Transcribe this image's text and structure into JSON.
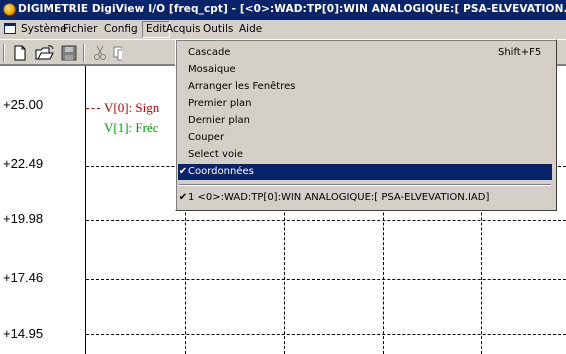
{
  "window": {
    "title": "DIGIMETRIE DigiView I/O [freq_cpt] - [<0>:WAD:TP[0]:WIN ANALOGIQUE:[ PSA-ELVEVATION.IAD]"
  },
  "menubar": {
    "items": [
      "Système",
      "Fichier",
      "Config",
      "Edit",
      "Acquis",
      "Outils",
      "Aide"
    ]
  },
  "edit_menu": {
    "items": [
      {
        "label": "Cascade",
        "shortcut": "Shift+F5",
        "checked": false,
        "selected": false
      },
      {
        "label": "Mosaique",
        "shortcut": "",
        "checked": false,
        "selected": false
      },
      {
        "label": "Arranger les Fenêtres",
        "shortcut": "",
        "checked": false,
        "selected": false
      },
      {
        "label": "Premier plan",
        "shortcut": "",
        "checked": false,
        "selected": false
      },
      {
        "label": "Dernier plan",
        "shortcut": "",
        "checked": false,
        "selected": false
      },
      {
        "label": "Couper",
        "shortcut": "",
        "checked": false,
        "selected": false
      },
      {
        "label": "Select voie",
        "shortcut": "",
        "checked": false,
        "selected": false
      },
      {
        "label": "Coordonnées",
        "shortcut": "",
        "checked": true,
        "selected": true
      }
    ],
    "window_list": [
      {
        "label": "1 <0>:WAD:TP[0]:WIN ANALOGIQUE:[ PSA-ELVEVATION.IAD]",
        "checked": true
      }
    ]
  },
  "plot": {
    "yticks": [
      "+25.00",
      "+22.49",
      "+19.98",
      "+17.46",
      "+14.95"
    ],
    "legend": [
      {
        "text": "V[0]: Sign",
        "color": "#c00000"
      },
      {
        "text": "V[1]: Fréc",
        "color": "#00a000"
      }
    ]
  },
  "colors": {
    "titlebar": "#0a246a",
    "selection": "#0a246a",
    "face": "#d4d0c8"
  }
}
